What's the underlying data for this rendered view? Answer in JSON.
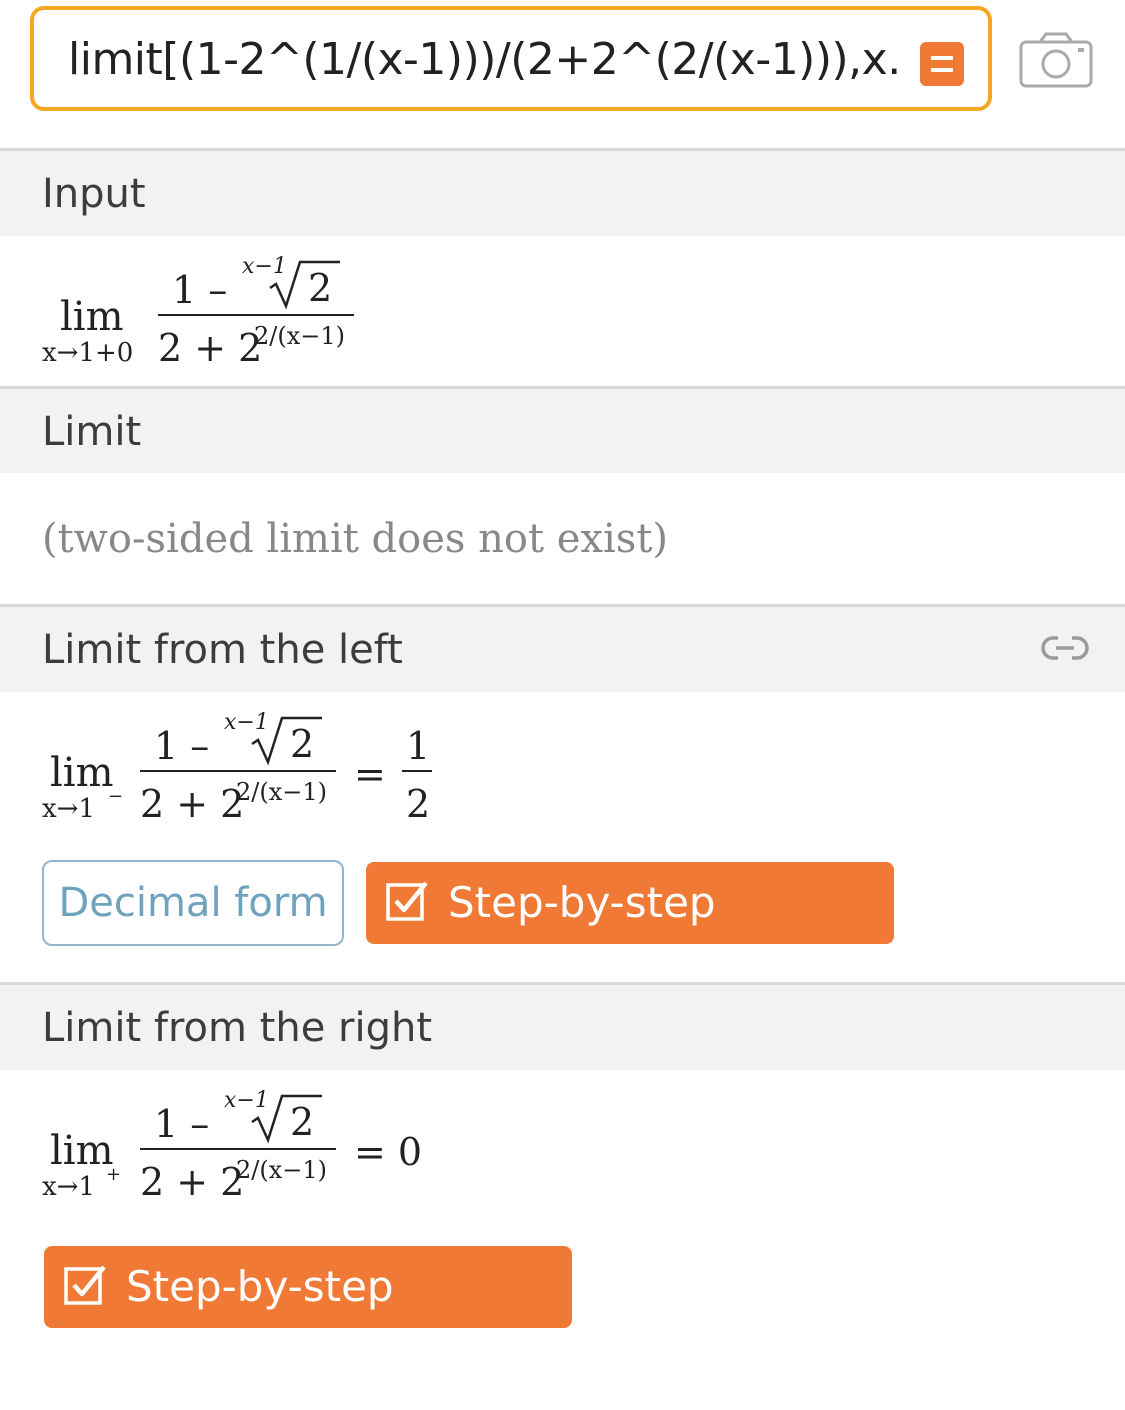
{
  "query": {
    "text": "limit[(1-2^(1/(x-1)))/(2+2^(2/(x-1))),x...",
    "equals_icon": "equals-icon",
    "camera_icon": "camera-icon"
  },
  "pods": {
    "input": {
      "title": "Input",
      "lim": "lim",
      "subscript": "x→1+0",
      "num_prefix": "1 –",
      "root_index": "x−1",
      "radicand": "2",
      "den_base": "2 + 2",
      "den_exp": "2/(x−1)"
    },
    "limit": {
      "title": "Limit",
      "result": "(two-sided limit does not exist)"
    },
    "left": {
      "title": "Limit from the left",
      "link_icon": "link-icon",
      "lim": "lim",
      "subscript": "x→1",
      "sub_sign": "−",
      "num_prefix": "1 –",
      "root_index": "x−1",
      "radicand": "2",
      "den_base": "2 + 2",
      "den_exp": "2/(x−1)",
      "equals": "=",
      "result_num": "1",
      "result_den": "2",
      "decimal_button": "Decimal form",
      "step_button": "Step-by-step solution"
    },
    "right": {
      "title": "Limit from the right",
      "lim": "lim",
      "subscript": "x→1",
      "sub_sign": "+",
      "num_prefix": "1 –",
      "root_index": "x−1",
      "radicand": "2",
      "den_base": "2 + 2",
      "den_exp": "2/(x−1)",
      "equals_result": "= 0",
      "step_button": "Step-by-step solution"
    }
  },
  "colors": {
    "accent_orange": "#f07a35",
    "query_border": "#f5a623",
    "decimal_border": "#8fb8cc"
  }
}
